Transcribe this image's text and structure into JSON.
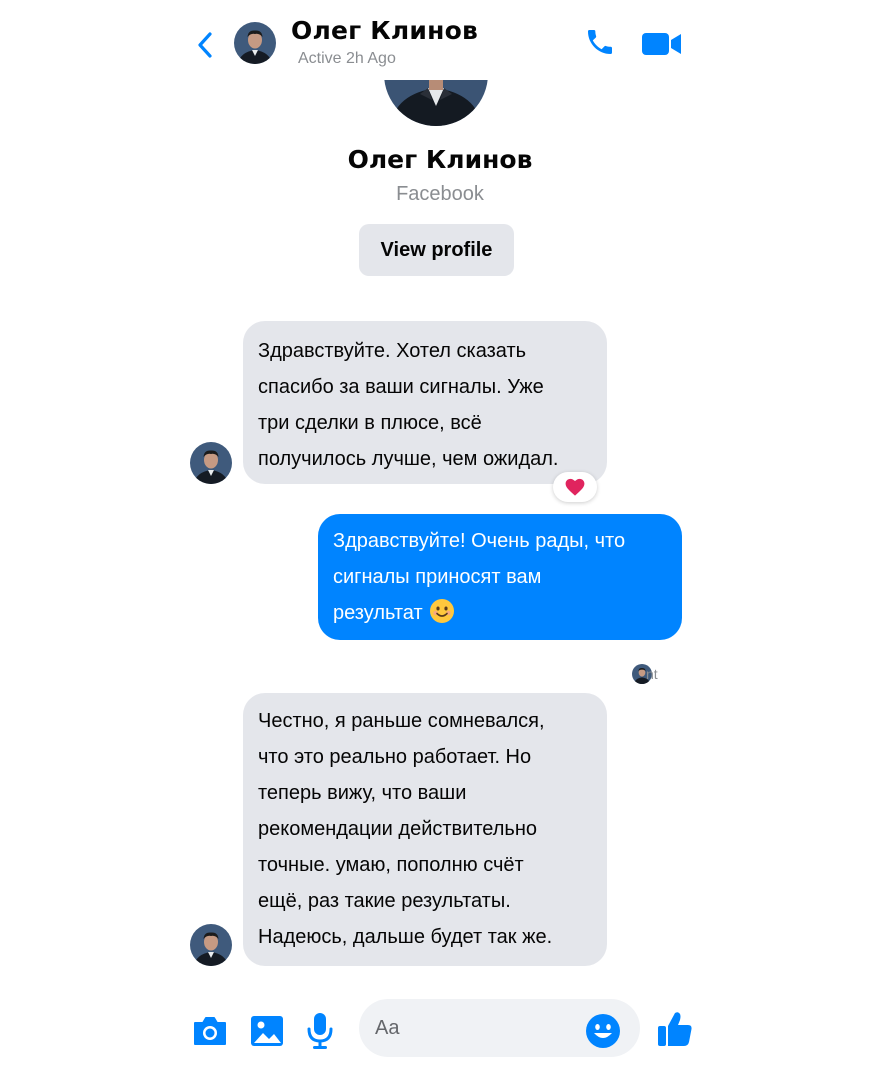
{
  "header": {
    "name": "Олег Клинов",
    "status": "Active 2h Ago",
    "icons": [
      "back-chevron-icon",
      "phone-icon",
      "video-camera-icon"
    ]
  },
  "profile": {
    "name": "Олег Клинов",
    "source": "Facebook",
    "view_profile_label": "View profile"
  },
  "messages": [
    {
      "direction": "incoming",
      "text": "Здравствуйте. Хотел сказать\nспасибо за ваши сигналы. Уже\nтри сделки в плюсе, всё\nполучилось лучше, чем ожидал.",
      "reaction": "heart"
    },
    {
      "direction": "outgoing",
      "text": "Здравствуйте! Очень рады, что\nсигналы приносят вам\nрезультат",
      "emoji": "smiling-face"
    },
    {
      "direction": "incoming",
      "text": "Честно, я раньше сомневался,\nчто это реально работает. Но\nтеперь вижу, что ваши\nрекомендации действительно\nточные. умаю, пополню счёт\nещё, раз такие результаты.\nНадеюсь, дальше будет так же."
    }
  ],
  "seen": {
    "label": "nt"
  },
  "composer": {
    "placeholder": "Aa",
    "icons": [
      "camera-icon",
      "image-icon",
      "microphone-icon",
      "emoji-icon",
      "thumbs-up-icon"
    ]
  },
  "colors": {
    "accent": "#0084ff",
    "incoming_bubble": "#e4e6eb",
    "muted_text": "#8a8d91"
  }
}
